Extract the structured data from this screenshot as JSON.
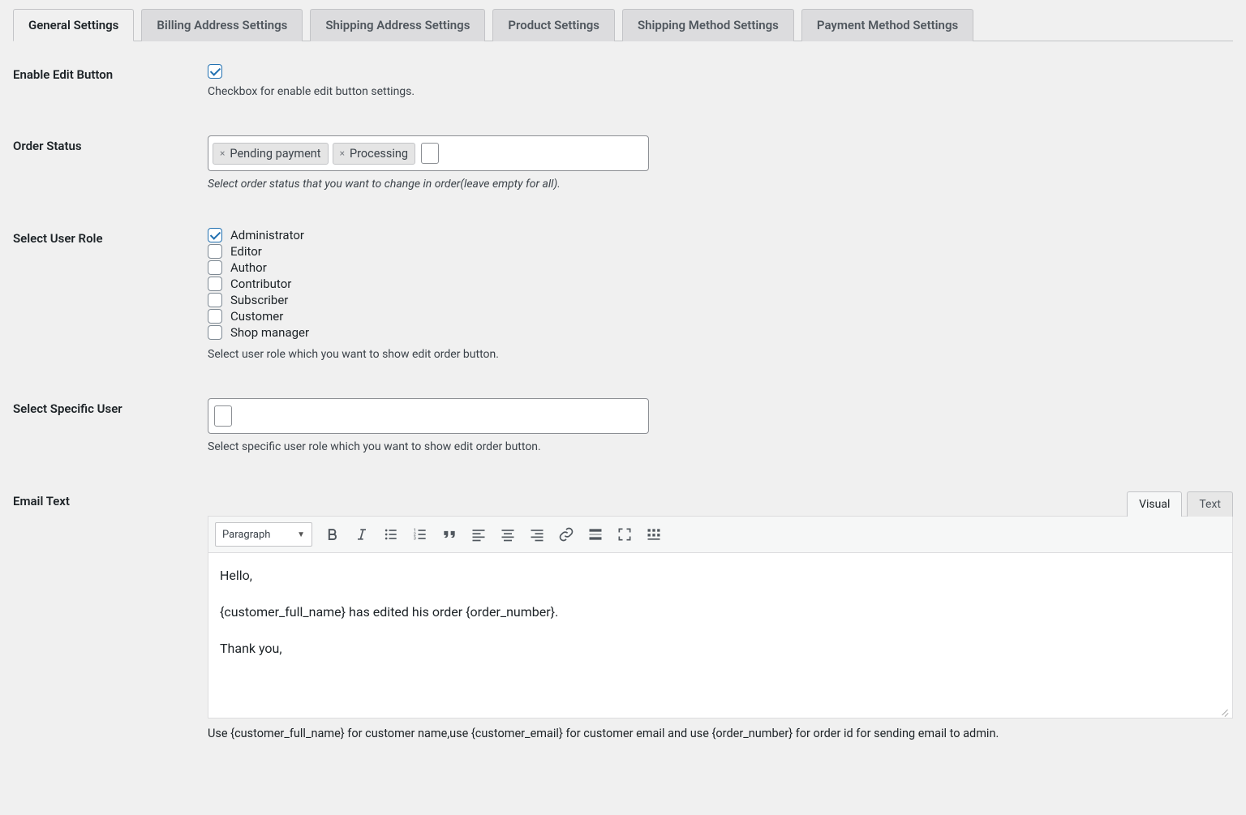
{
  "tabs": [
    {
      "label": "General Settings",
      "active": true
    },
    {
      "label": "Billing Address Settings",
      "active": false
    },
    {
      "label": "Shipping Address Settings",
      "active": false
    },
    {
      "label": "Product Settings",
      "active": false
    },
    {
      "label": "Shipping Method Settings",
      "active": false
    },
    {
      "label": "Payment Method Settings",
      "active": false
    }
  ],
  "enable_edit": {
    "label": "Enable Edit Button",
    "checked": true,
    "desc": "Checkbox for enable edit button settings."
  },
  "order_status": {
    "label": "Order Status",
    "tags": [
      "Pending payment",
      "Processing"
    ],
    "desc": "Select order status that you want to change in order(leave empty for all)."
  },
  "user_role": {
    "label": "Select User Role",
    "roles": [
      {
        "name": "Administrator",
        "checked": true
      },
      {
        "name": "Editor",
        "checked": false
      },
      {
        "name": "Author",
        "checked": false
      },
      {
        "name": "Contributor",
        "checked": false
      },
      {
        "name": "Subscriber",
        "checked": false
      },
      {
        "name": "Customer",
        "checked": false
      },
      {
        "name": "Shop manager",
        "checked": false
      }
    ],
    "desc": "Select user role which you want to show edit order button."
  },
  "specific_user": {
    "label": "Select Specific User",
    "desc": "Select specific user role which you want to show edit order button."
  },
  "email": {
    "label": "Email Text",
    "tabs": {
      "visual": "Visual",
      "text": "Text"
    },
    "format": "Paragraph",
    "body": {
      "line1": "Hello,",
      "line2": "{customer_full_name} has edited his order {order_number}.",
      "line3": "Thank you,"
    },
    "hint": "Use {customer_full_name} for customer name,use {customer_email} for customer email and use {order_number} for order id for sending email to admin."
  }
}
